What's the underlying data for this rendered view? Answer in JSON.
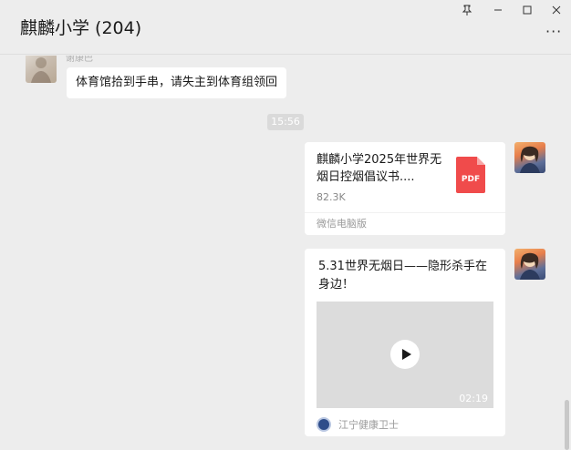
{
  "header": {
    "title": "麒麟小学 (204)",
    "pin_icon": "pin-icon",
    "minimize_icon": "minimize-icon",
    "maximize_icon": "maximize-icon",
    "close_icon": "close-icon",
    "more_icon": "more-icon"
  },
  "messages": [
    {
      "type": "text",
      "side": "left",
      "sender": "谢康巴",
      "text": "体育馆拾到手串，请失主到体育组领回"
    },
    {
      "type": "timestamp",
      "text": "15:56"
    },
    {
      "type": "file",
      "side": "right",
      "file_name": "麒麟小学2025年世界无烟日控烟倡议书....",
      "file_size": "82.3K",
      "file_type_label": "PDF",
      "source": "微信电脑版"
    },
    {
      "type": "video",
      "side": "right",
      "title": "5.31世界无烟日——隐形杀手在身边！",
      "duration": "02:19",
      "source": "江宁健康卫士"
    }
  ],
  "colors": {
    "background": "#ededed",
    "bubble": "#ffffff",
    "pdf_red": "#f04b4b",
    "timestamp_bg": "#dadada"
  }
}
